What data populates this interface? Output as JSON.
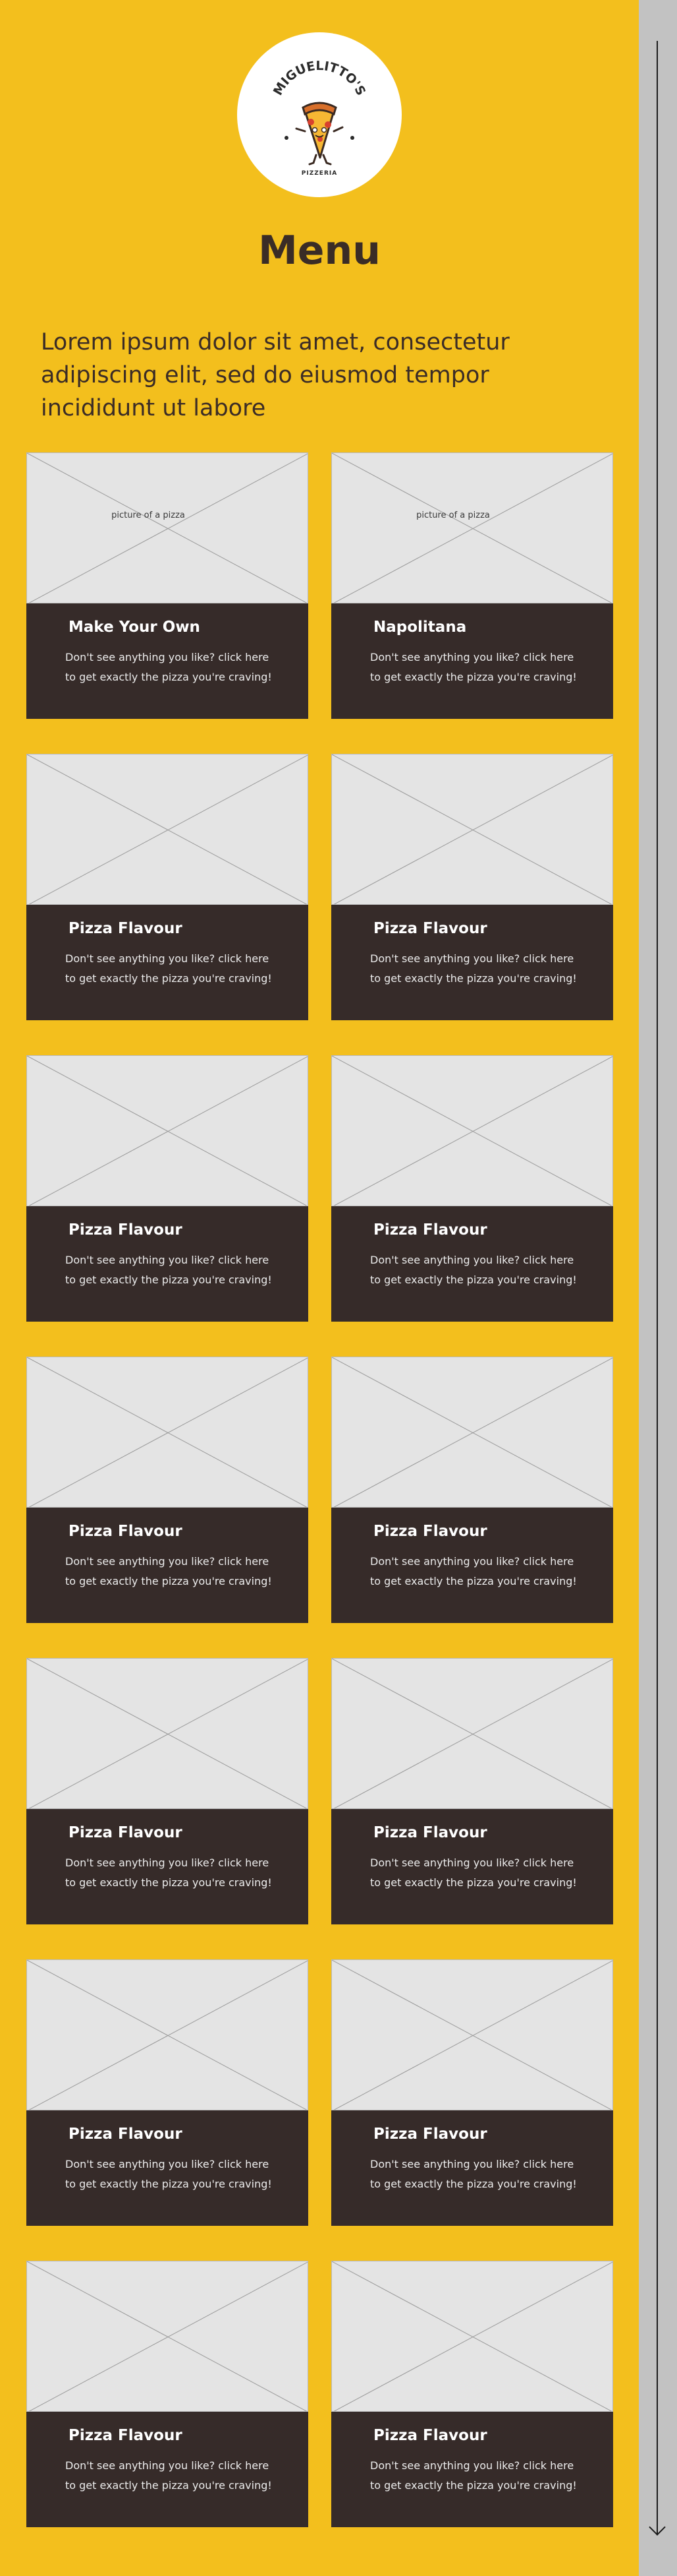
{
  "brand": {
    "logo_title": "MIGUELITTO'S",
    "logo_subtitle": "PIZZERIA",
    "colors": {
      "background": "#f3bf1d",
      "card_dark": "#362b29",
      "placeholder": "#e4e4e4",
      "scroll_rail": "#c2c2c2"
    }
  },
  "page_title": "Menu",
  "intro_text": "Lorem ipsum dolor sit amet, consectetur adipiscing elit, sed do eiusmod tempor incididunt ut labore",
  "menu_items": [
    {
      "name": "Make Your Own",
      "description": "Don't see anything you like? click here to get exactly the pizza you're craving!",
      "image_label": "picture of a pizza"
    },
    {
      "name": "Napolitana",
      "description": "Don't see anything you like? click here to get exactly the pizza you're craving!",
      "image_label": "picture of a pizza"
    },
    {
      "name": "Pizza Flavour",
      "description": "Don't see anything you like? click here to get exactly the pizza you're craving!",
      "image_label": ""
    },
    {
      "name": "Pizza Flavour",
      "description": "Don't see anything you like? click here to get exactly the pizza you're craving!",
      "image_label": ""
    },
    {
      "name": "Pizza Flavour",
      "description": "Don't see anything you like? click here to get exactly the pizza you're craving!",
      "image_label": ""
    },
    {
      "name": "Pizza Flavour",
      "description": "Don't see anything you like? click here to get exactly the pizza you're craving!",
      "image_label": ""
    },
    {
      "name": "Pizza Flavour",
      "description": "Don't see anything you like? click here to get exactly the pizza you're craving!",
      "image_label": ""
    },
    {
      "name": "Pizza Flavour",
      "description": "Don't see anything you like? click here to get exactly the pizza you're craving!",
      "image_label": ""
    },
    {
      "name": "Pizza Flavour",
      "description": "Don't see anything you like? click here to get exactly the pizza you're craving!",
      "image_label": ""
    },
    {
      "name": "Pizza Flavour",
      "description": "Don't see anything you like? click here to get exactly the pizza you're craving!",
      "image_label": ""
    },
    {
      "name": "Pizza Flavour",
      "description": "Don't see anything you like? click here to get exactly the pizza you're craving!",
      "image_label": ""
    },
    {
      "name": "Pizza Flavour",
      "description": "Don't see anything you like? click here to get exactly the pizza you're craving!",
      "image_label": ""
    },
    {
      "name": "Pizza Flavour",
      "description": "Don't see anything you like? click here to get exactly the pizza you're craving!",
      "image_label": ""
    },
    {
      "name": "Pizza Flavour",
      "description": "Don't see anything you like? click here to get exactly the pizza you're craving!",
      "image_label": ""
    }
  ],
  "scrollbar": {
    "icon": "arrow-down-icon"
  }
}
